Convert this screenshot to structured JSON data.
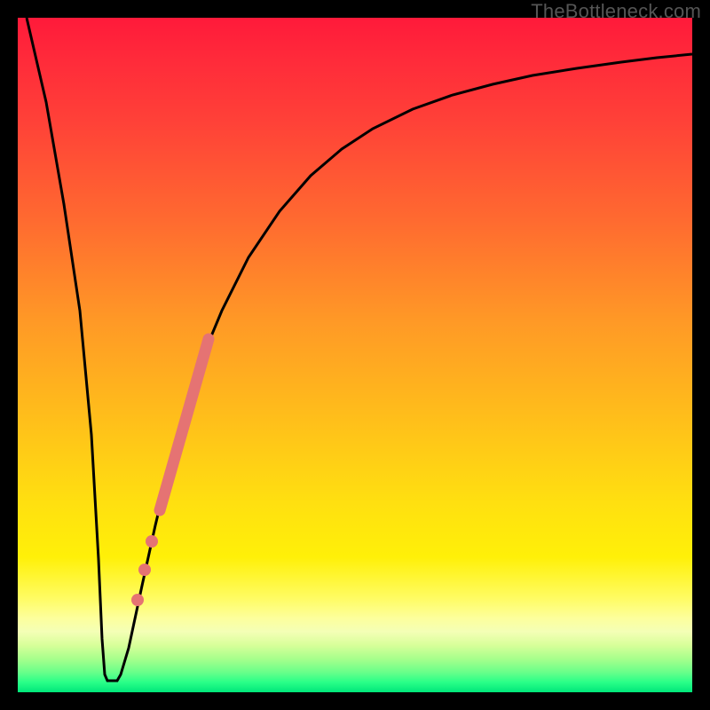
{
  "watermark": "TheBottleneck.com",
  "colors": {
    "frame": "#000000",
    "curve": "#000000",
    "marker": "#e57373",
    "marker_line": "#e57373"
  },
  "chart_data": {
    "type": "line",
    "title": "",
    "xlabel": "",
    "ylabel": "",
    "xlim": [
      0,
      100
    ],
    "ylim": [
      0,
      100
    ],
    "grid": false,
    "legend": false,
    "series": [
      {
        "name": "bottleneck-curve",
        "x": [
          0,
          2,
          4,
          6,
          8,
          10,
          11,
          11.5,
          12,
          13,
          14,
          16,
          18,
          20,
          22,
          24,
          26,
          28,
          30,
          34,
          38,
          42,
          46,
          50,
          55,
          60,
          65,
          70,
          76,
          82,
          88,
          94,
          100
        ],
        "values": [
          100,
          88,
          75,
          62,
          48,
          30,
          14,
          4,
          2,
          3,
          6,
          14,
          22,
          30,
          37,
          44,
          50,
          55,
          60,
          67,
          73,
          77,
          80,
          83,
          86,
          88,
          89.5,
          91,
          92,
          93,
          93.6,
          94.2,
          94.6
        ]
      }
    ],
    "markers": {
      "type": "scatter",
      "name": "highlighted-range",
      "x": [
        17.5,
        18.5,
        19.5,
        21,
        22,
        23,
        24,
        25,
        26,
        27,
        28
      ],
      "values": [
        20,
        24,
        28,
        33,
        37,
        41,
        44,
        47,
        50,
        53,
        55.5
      ],
      "style": "thick-line-with-dots"
    }
  }
}
